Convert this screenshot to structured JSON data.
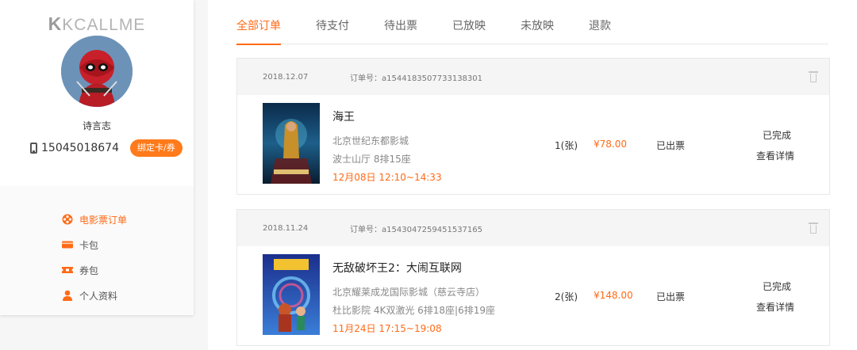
{
  "brand": {
    "logo_mark": "K",
    "logo_text": "KCALLME"
  },
  "profile": {
    "username": "诗言志",
    "phone": "15045018674",
    "bind_button": "绑定卡/券"
  },
  "menu": [
    {
      "label": "电影票订单",
      "icon": "film-reel-icon",
      "active": true
    },
    {
      "label": "卡包",
      "icon": "card-icon",
      "active": false
    },
    {
      "label": "券包",
      "icon": "coupon-icon",
      "active": false
    },
    {
      "label": "个人资料",
      "icon": "person-icon",
      "active": false
    }
  ],
  "tabs": [
    {
      "label": "全部订单",
      "active": true
    },
    {
      "label": "待支付",
      "active": false
    },
    {
      "label": "待出票",
      "active": false
    },
    {
      "label": "已放映",
      "active": false
    },
    {
      "label": "未放映",
      "active": false
    },
    {
      "label": "退款",
      "active": false
    }
  ],
  "orders": [
    {
      "date": "2018.12.07",
      "order_no": "订单号：a1544183507733138301",
      "title": "海王",
      "cinema": "北京世纪东都影城",
      "hall_seat": "波士山厅 8排15座",
      "showtime": "12月08日 12:10~14:33",
      "quantity": "1(张)",
      "price": "¥78.00",
      "ticket_status": "已出票",
      "order_status": "已完成",
      "detail_label": "查看详情"
    },
    {
      "date": "2018.11.24",
      "order_no": "订单号：a1543047259451537165",
      "title": "无敌破坏王2：大闹互联网",
      "cinema": "北京耀莱成龙国际影城（慈云寺店）",
      "hall_seat": "杜比影院 4K双激光 6排18座|6排19座",
      "showtime": "11月24日 17:15~19:08",
      "quantity": "2(张)",
      "price": "¥148.00",
      "ticket_status": "已出票",
      "order_status": "已完成",
      "detail_label": "查看详情"
    }
  ],
  "colors": {
    "accent": "#ff6a16",
    "button": "#ff7a1a"
  }
}
